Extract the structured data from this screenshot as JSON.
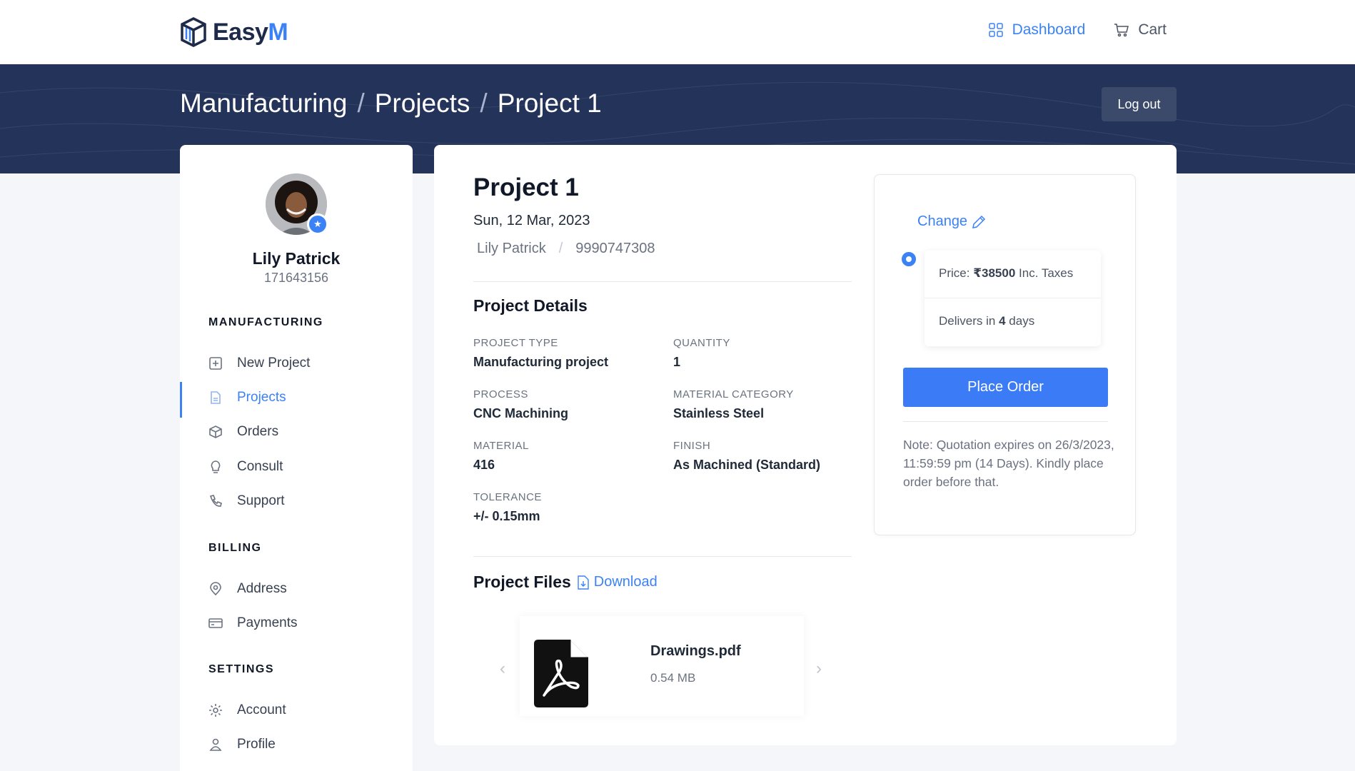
{
  "brand": {
    "name_main": "Easy",
    "name_accent": "M"
  },
  "nav": {
    "dashboard_label": "Dashboard",
    "cart_label": "Cart"
  },
  "breadcrumb": [
    "Manufacturing",
    "Projects",
    "Project 1"
  ],
  "breadcrumb_sep": "/",
  "logout_label": "Log out",
  "user": {
    "name": "Lily Patrick",
    "id": "171643156"
  },
  "sidebar": {
    "sections": [
      {
        "title": "MANUFACTURING",
        "items": [
          {
            "label": "New Project",
            "icon": "plus-square-icon"
          },
          {
            "label": "Projects",
            "icon": "document-icon",
            "active": true
          },
          {
            "label": "Orders",
            "icon": "box-icon"
          },
          {
            "label": "Consult",
            "icon": "lightbulb-icon"
          },
          {
            "label": "Support",
            "icon": "phone-icon"
          }
        ]
      },
      {
        "title": "BILLING",
        "items": [
          {
            "label": "Address",
            "icon": "map-pin-icon"
          },
          {
            "label": "Payments",
            "icon": "credit-card-icon"
          }
        ]
      },
      {
        "title": "SETTINGS",
        "items": [
          {
            "label": "Account",
            "icon": "gear-icon"
          },
          {
            "label": "Profile",
            "icon": "user-icon"
          }
        ]
      }
    ]
  },
  "project": {
    "title": "Project 1",
    "date": "Sun, 12 Mar, 2023",
    "owner": "Lily Patrick",
    "phone": "9990747308",
    "details_heading": "Project Details",
    "fields": [
      {
        "label": "PROJECT TYPE",
        "value": "Manufacturing project"
      },
      {
        "label": "QUANTITY",
        "value": "1"
      },
      {
        "label": "PROCESS",
        "value": "CNC Machining"
      },
      {
        "label": "MATERIAL CATEGORY",
        "value": "Stainless Steel"
      },
      {
        "label": "MATERIAL",
        "value": "416"
      },
      {
        "label": "FINISH",
        "value": "As Machined (Standard)"
      },
      {
        "label": "TOLERANCE",
        "value": "+/- 0.15mm"
      }
    ],
    "files_heading": "Project Files",
    "download_label": "Download",
    "files": [
      {
        "name": "Drawings.pdf",
        "size": "0.54 MB"
      }
    ]
  },
  "quote": {
    "change_label": "Change",
    "price_prefix": "Price: ",
    "price_value": "₹38500",
    "price_suffix": " Inc. Taxes",
    "delivery_prefix": "Delivers in ",
    "delivery_days": "4",
    "delivery_suffix": " days",
    "place_order_label": "Place Order",
    "note": "Note: Quotation expires on 26/3/2023, 11:59:59 pm (14 Days). Kindly place order before that."
  },
  "colors": {
    "accent": "#3b82f6",
    "hero": "#233359",
    "button": "#3b7bf5"
  }
}
